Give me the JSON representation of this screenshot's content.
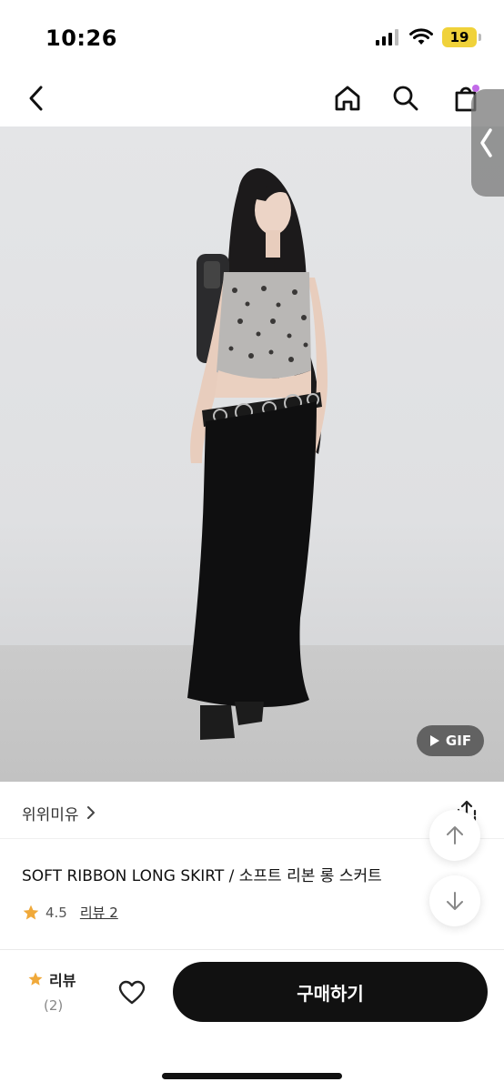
{
  "status_bar": {
    "time": "10:26",
    "battery": "19"
  },
  "nav": {
    "back_icon": "chevron-left-icon",
    "home_icon": "home-icon",
    "search_icon": "search-icon",
    "cart_icon": "shopping-bag-icon"
  },
  "hero": {
    "gif_badge": "GIF"
  },
  "product": {
    "brand": "위위미유",
    "brand_chevron": ">",
    "title": "SOFT RIBBON LONG SKIRT / 소프트 리본 롱 스커트",
    "rating": "4.5",
    "review_link": "리뷰 2"
  },
  "bottom_bar": {
    "review_label": "리뷰",
    "review_count": "(2)",
    "buy_label": "구매하기"
  },
  "colors": {
    "star": "#f0a93a",
    "buy_button": "#111111",
    "battery": "#f0d23a"
  }
}
